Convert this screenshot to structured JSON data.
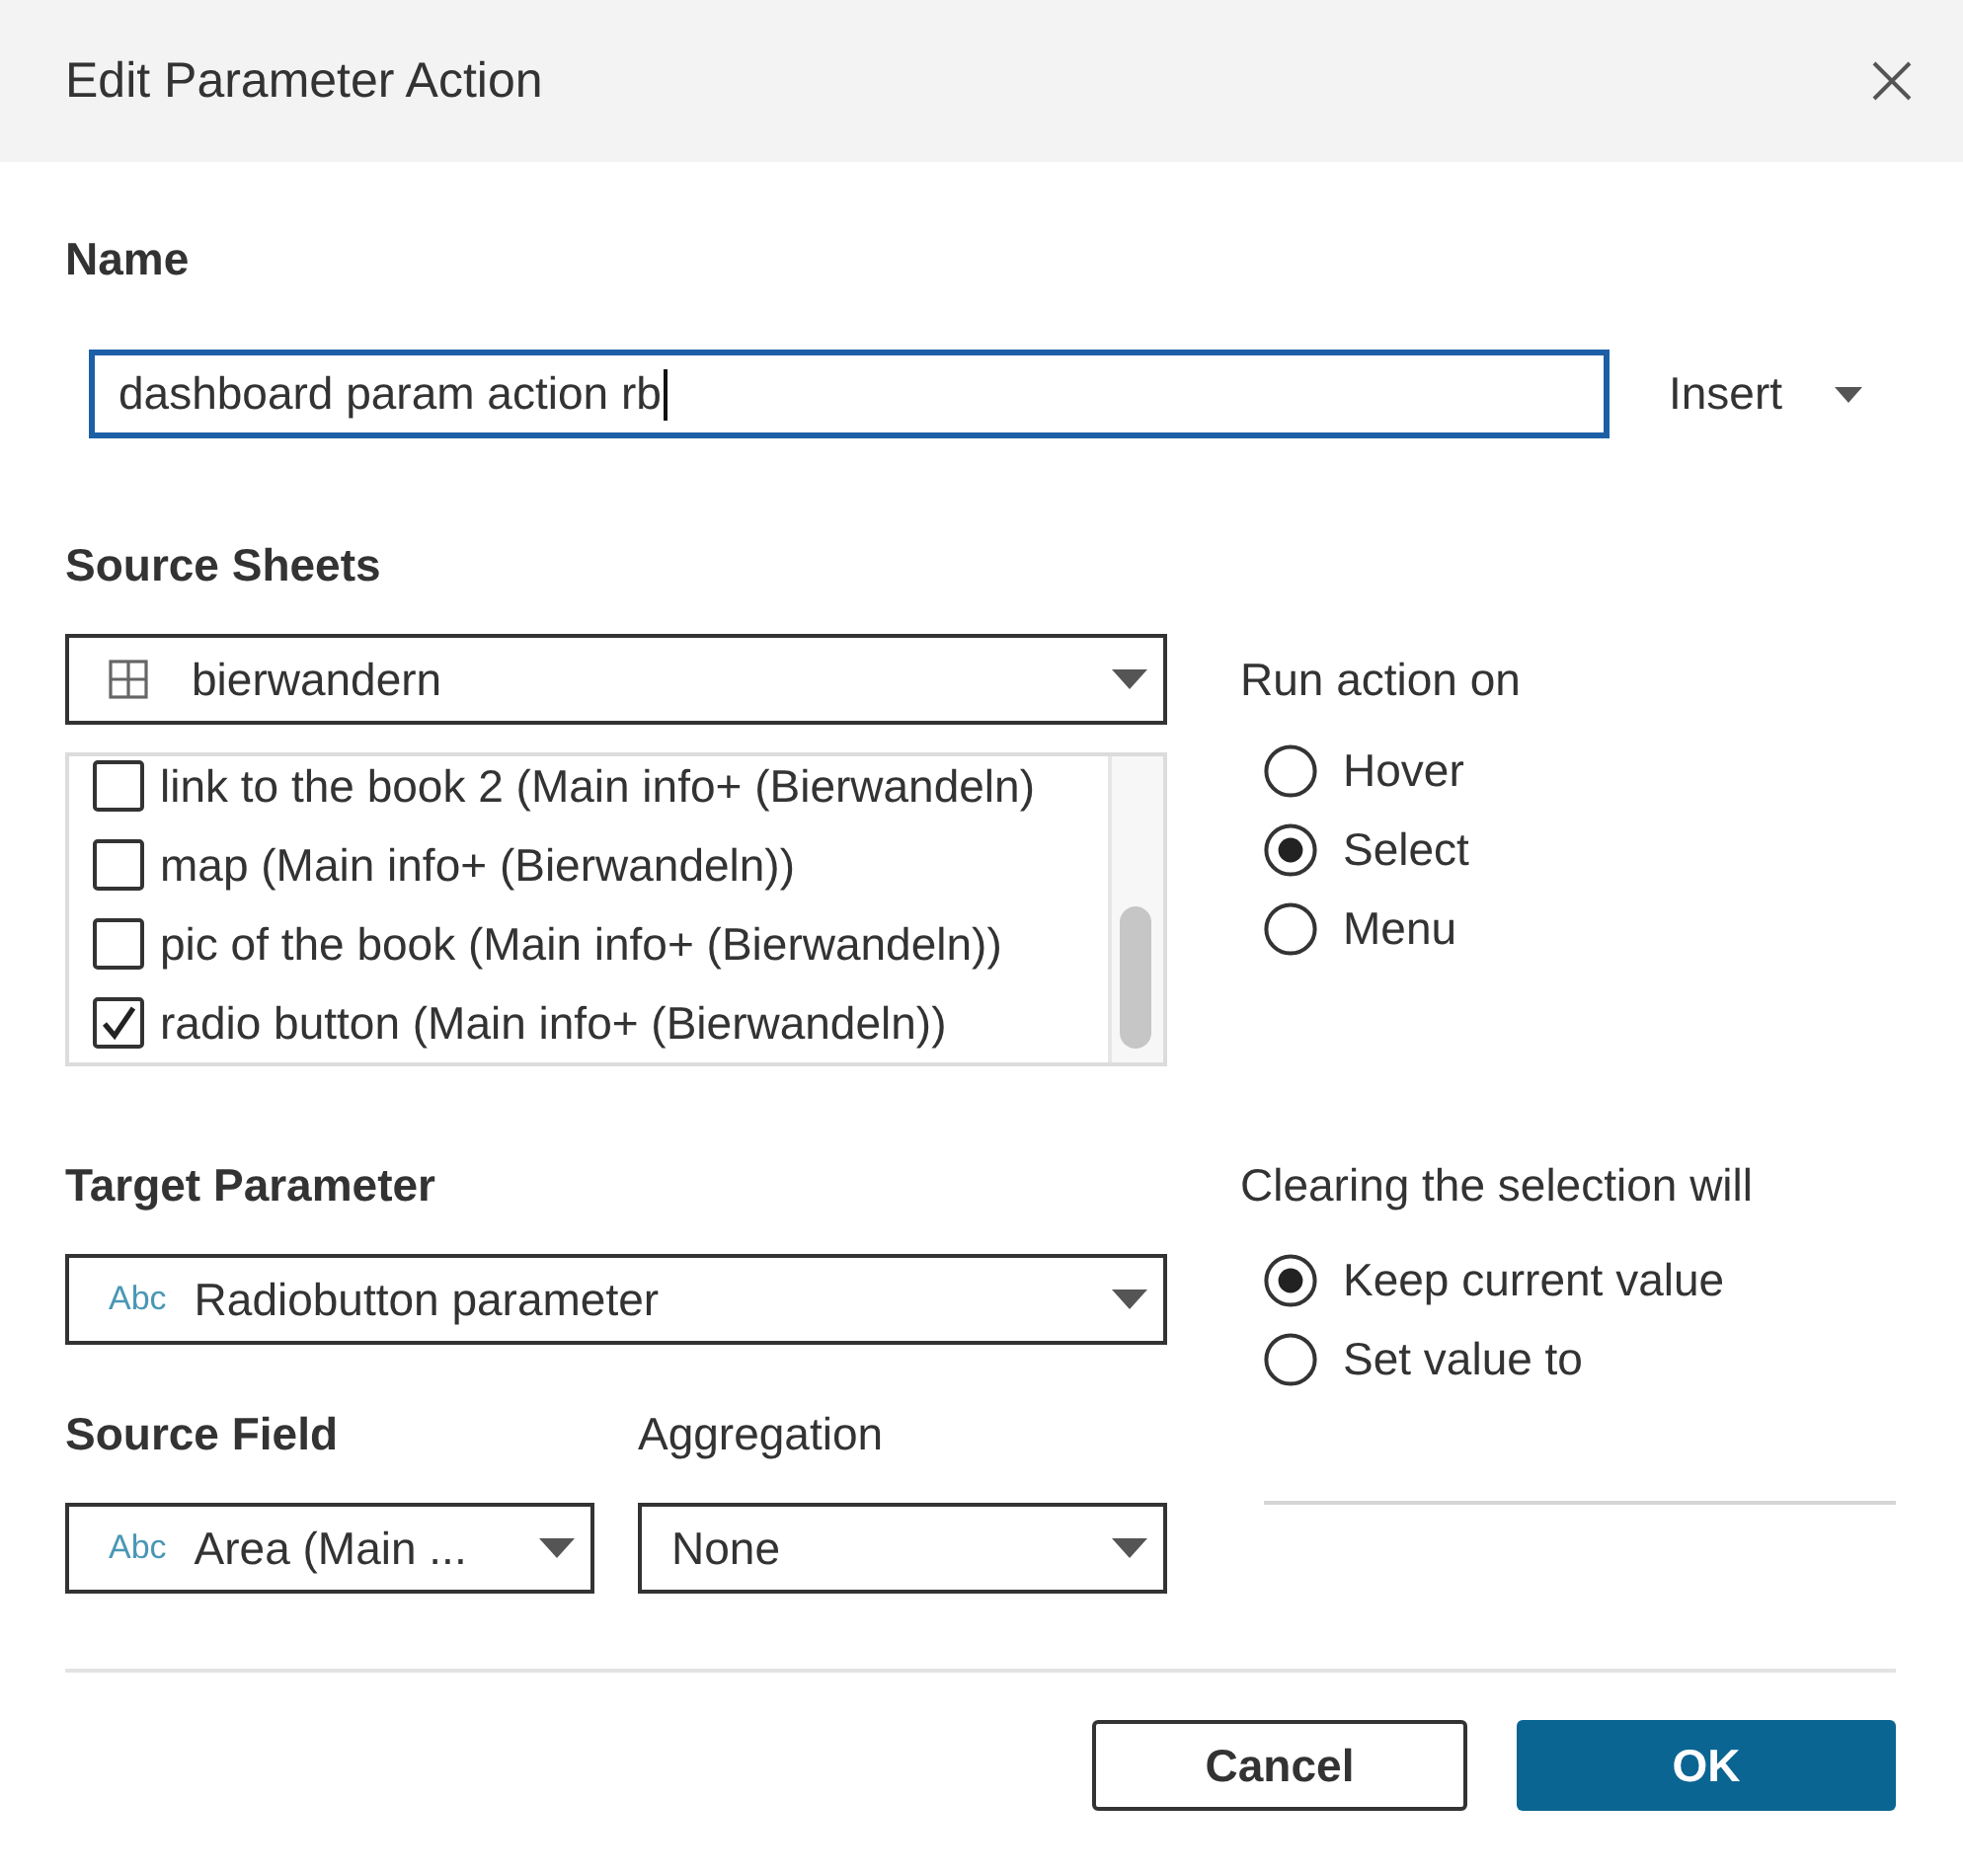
{
  "dialog": {
    "title": "Edit Parameter Action"
  },
  "name": {
    "label": "Name",
    "value": "dashboard param action rb",
    "focused": true,
    "insert": "Insert"
  },
  "source_sheets": {
    "label": "Source Sheets",
    "dropdown": "bierwandern",
    "sheets": [
      {
        "label": "link to the book 2 (Main info+ (Bierwandeln)",
        "checked": false
      },
      {
        "label": "map (Main info+ (Bierwandeln))",
        "checked": false
      },
      {
        "label": "pic of the book (Main info+ (Bierwandeln))",
        "checked": false
      },
      {
        "label": "radio button (Main info+ (Bierwandeln))",
        "checked": true
      }
    ]
  },
  "run_action_on": {
    "label": "Run action on",
    "options": [
      {
        "label": "Hover",
        "selected": false
      },
      {
        "label": "Select",
        "selected": true
      },
      {
        "label": "Menu",
        "selected": false
      }
    ]
  },
  "target_parameter": {
    "label": "Target Parameter",
    "type_tag": "Abc",
    "value": "Radiobutton parameter"
  },
  "source_field": {
    "label": "Source Field",
    "type_tag": "Abc",
    "value": "Area (Main ..."
  },
  "aggregation": {
    "label": "Aggregation",
    "value": "None"
  },
  "clearing": {
    "label": "Clearing the selection will",
    "options": [
      {
        "label": "Keep current value",
        "selected": true
      },
      {
        "label": "Set value to",
        "selected": false
      }
    ],
    "value_field": {
      "disabled": true
    }
  },
  "buttons": [
    {
      "label": "Cancel",
      "kind": "secondary"
    },
    {
      "label": "OK",
      "kind": "primary"
    }
  ]
}
